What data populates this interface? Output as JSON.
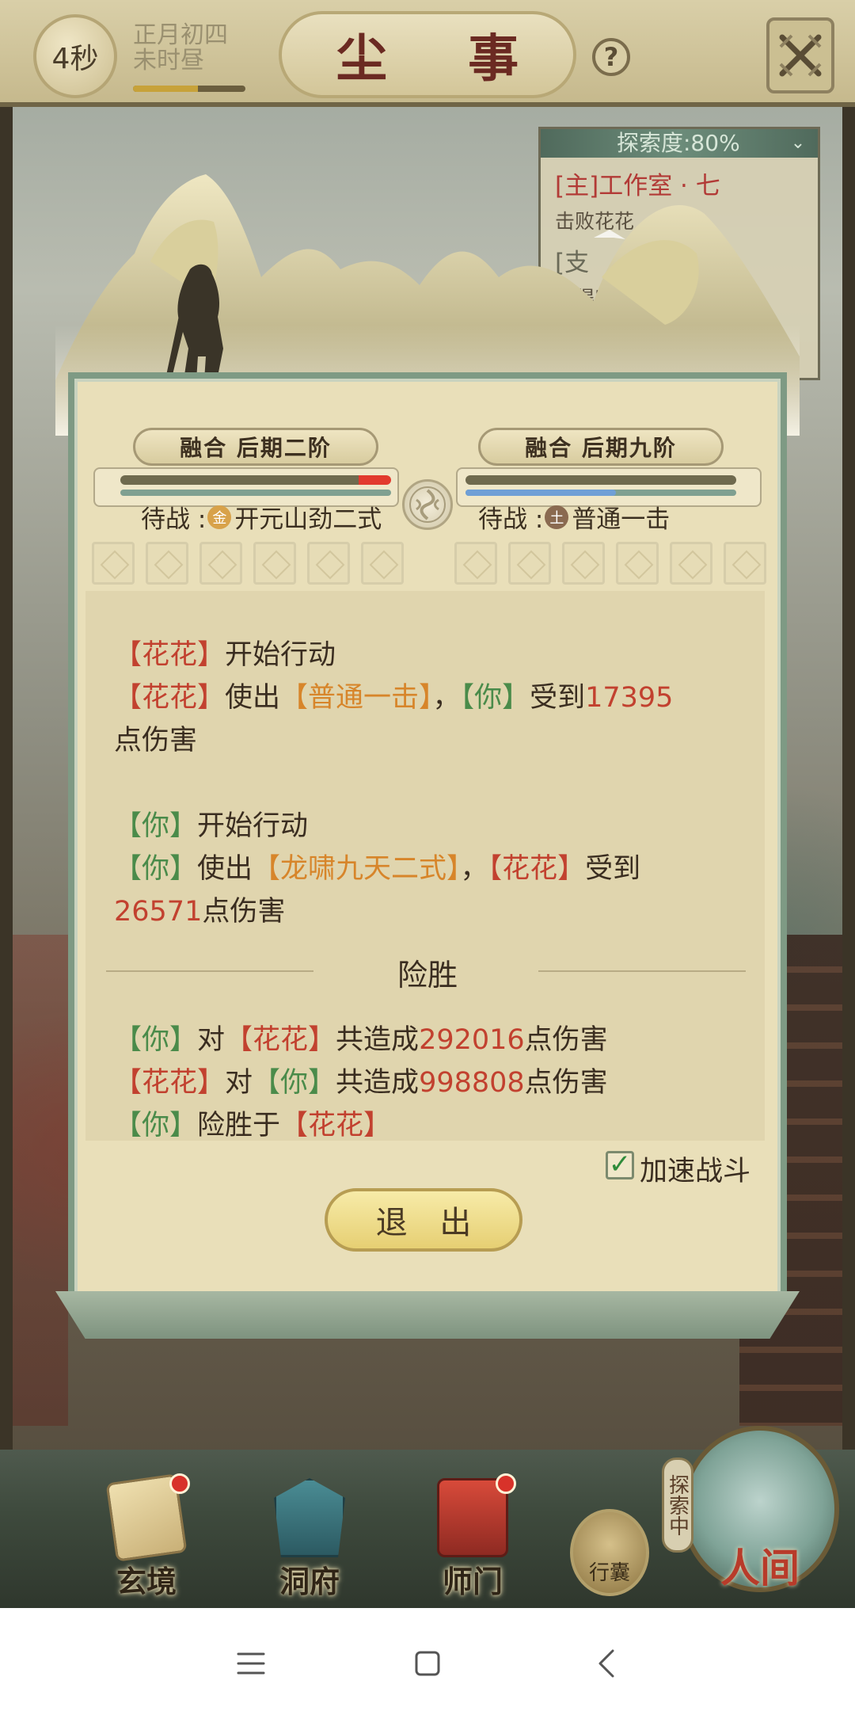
{
  "topbar": {
    "timer": "4秒",
    "date_line1": "正月初四",
    "date_line2": "未时昼",
    "title": "尘 事",
    "help_label": "?"
  },
  "quest": {
    "exploration": "探索度:80%",
    "items": [
      {
        "title": "[主]工作室 · 七",
        "desc": "击败花花"
      },
      {
        "title": "[支",
        "desc": "获得所有"
      }
    ]
  },
  "battle": {
    "player": {
      "rank": "融合 后期二阶",
      "standby_prefix": "待战 :",
      "element": "金",
      "skill": "开元山劲二式",
      "hp_fraction": 0.88
    },
    "enemy": {
      "rank": "融合 后期九阶",
      "standby_prefix": "待战 :",
      "element": "土",
      "skill": "普通一击",
      "hp_fraction": 1.0
    }
  },
  "log": {
    "l1_a": "【花花】",
    "l1_b": "开始行动",
    "l2_a": "【花花】",
    "l2_b": "使出",
    "l2_c": "【普通一击】",
    "l2_d": "，",
    "l2_e": "【你】",
    "l2_f": "受到",
    "l2_g": "17395",
    "l3": "点伤害",
    "l4_a": "【你】",
    "l4_b": "开始行动",
    "l5_a": "【你】",
    "l5_b": "使出",
    "l5_c": "【龙啸九天二式】",
    "l5_d": "，",
    "l5_e": "【花花】",
    "l5_f": "受到",
    "l6_a": "26571",
    "l6_b": "点伤害",
    "result_title": "险胜",
    "r1_a": "【你】",
    "r1_b": "对",
    "r1_c": "【花花】",
    "r1_d": "共造成",
    "r1_e": "292016",
    "r1_f": "点伤害",
    "r2_a": "【花花】",
    "r2_b": "对",
    "r2_c": "【你】",
    "r2_d": "共造成",
    "r2_e": "998808",
    "r2_f": "点伤害",
    "r3_a": "【你】",
    "r3_b": "险胜于",
    "r3_c": "【花花】"
  },
  "controls": {
    "speed_label": "加速战斗",
    "speed_checked": true,
    "exit_label": "退 出"
  },
  "bottom_nav": {
    "items": [
      {
        "label": "玄境"
      },
      {
        "label": "洞府"
      },
      {
        "label": "师门"
      }
    ],
    "bag_label": "行囊",
    "exploring_tag": "探索中",
    "world_label": "人间"
  },
  "colors": {
    "damage_red": "#c2412f",
    "player_green": "#4a8b4a",
    "skill_orange": "#d7852a"
  }
}
